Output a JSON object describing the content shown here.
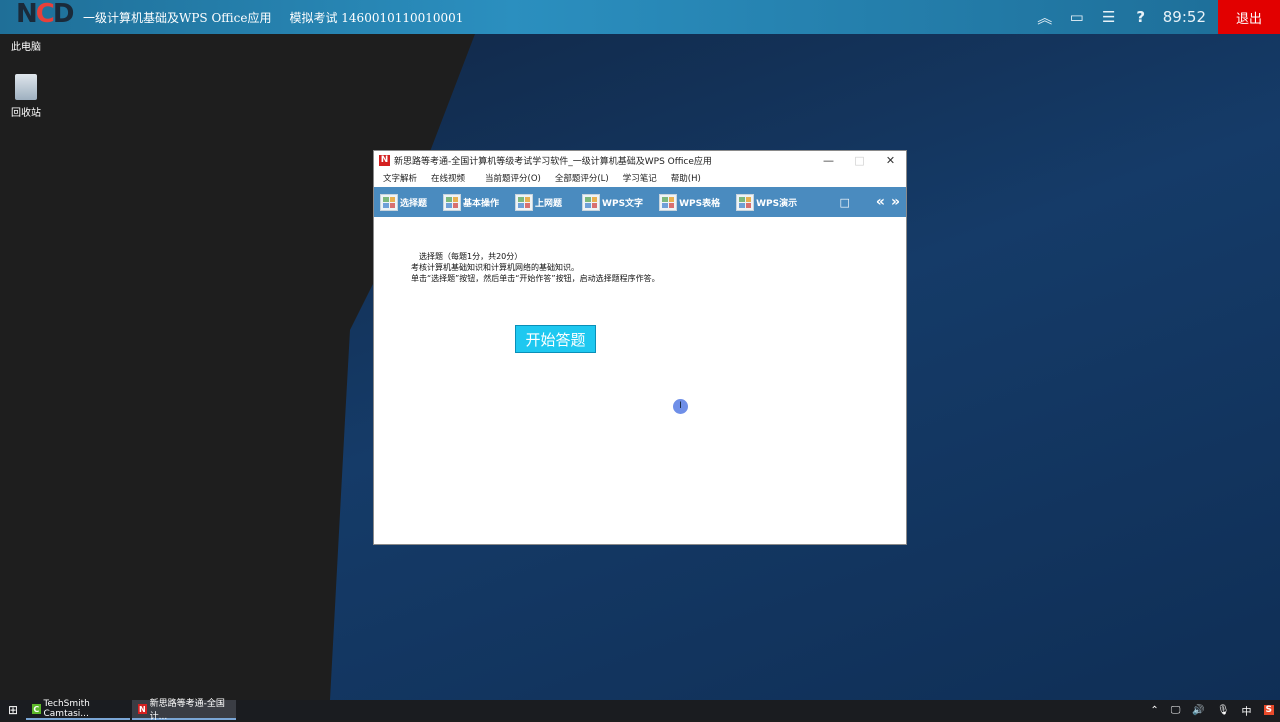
{
  "topbar": {
    "logo": "NCD",
    "course": "一级计算机基础及WPS Office应用",
    "exam": "模拟考试 1460010110010001",
    "timer": "89:52",
    "exit": "退出",
    "icons": [
      "chevron-double-up-icon",
      "window-icon",
      "checklist-icon",
      "help-icon"
    ]
  },
  "desktop": [
    {
      "label": "此电脑"
    },
    {
      "label": "回收站"
    }
  ],
  "window": {
    "title": "新思路等考通-全国计算机等级考试学习软件_一级计算机基础及WPS Office应用",
    "menu": [
      "文字解析",
      "在线视频",
      "当前题评分(O)",
      "全部题评分(L)",
      "学习笔记",
      "帮助(H)"
    ],
    "toolbar": [
      "选择题",
      "基本操作",
      "上网题",
      "WPS文字",
      "WPS表格",
      "WPS演示"
    ],
    "content": {
      "line1": "选择题（每题1分，共20分）",
      "line2": "考核计算机基础知识和计算机网络的基础知识。",
      "line3": "单击“选择题”按钮，然后单击“开始作答”按钮，启动选择题程序作答。"
    },
    "start_button": "开始答题"
  },
  "taskbar": {
    "tasks": [
      "TechSmith Camtasi...",
      "新思路等考通-全国计..."
    ],
    "ime": "中"
  }
}
